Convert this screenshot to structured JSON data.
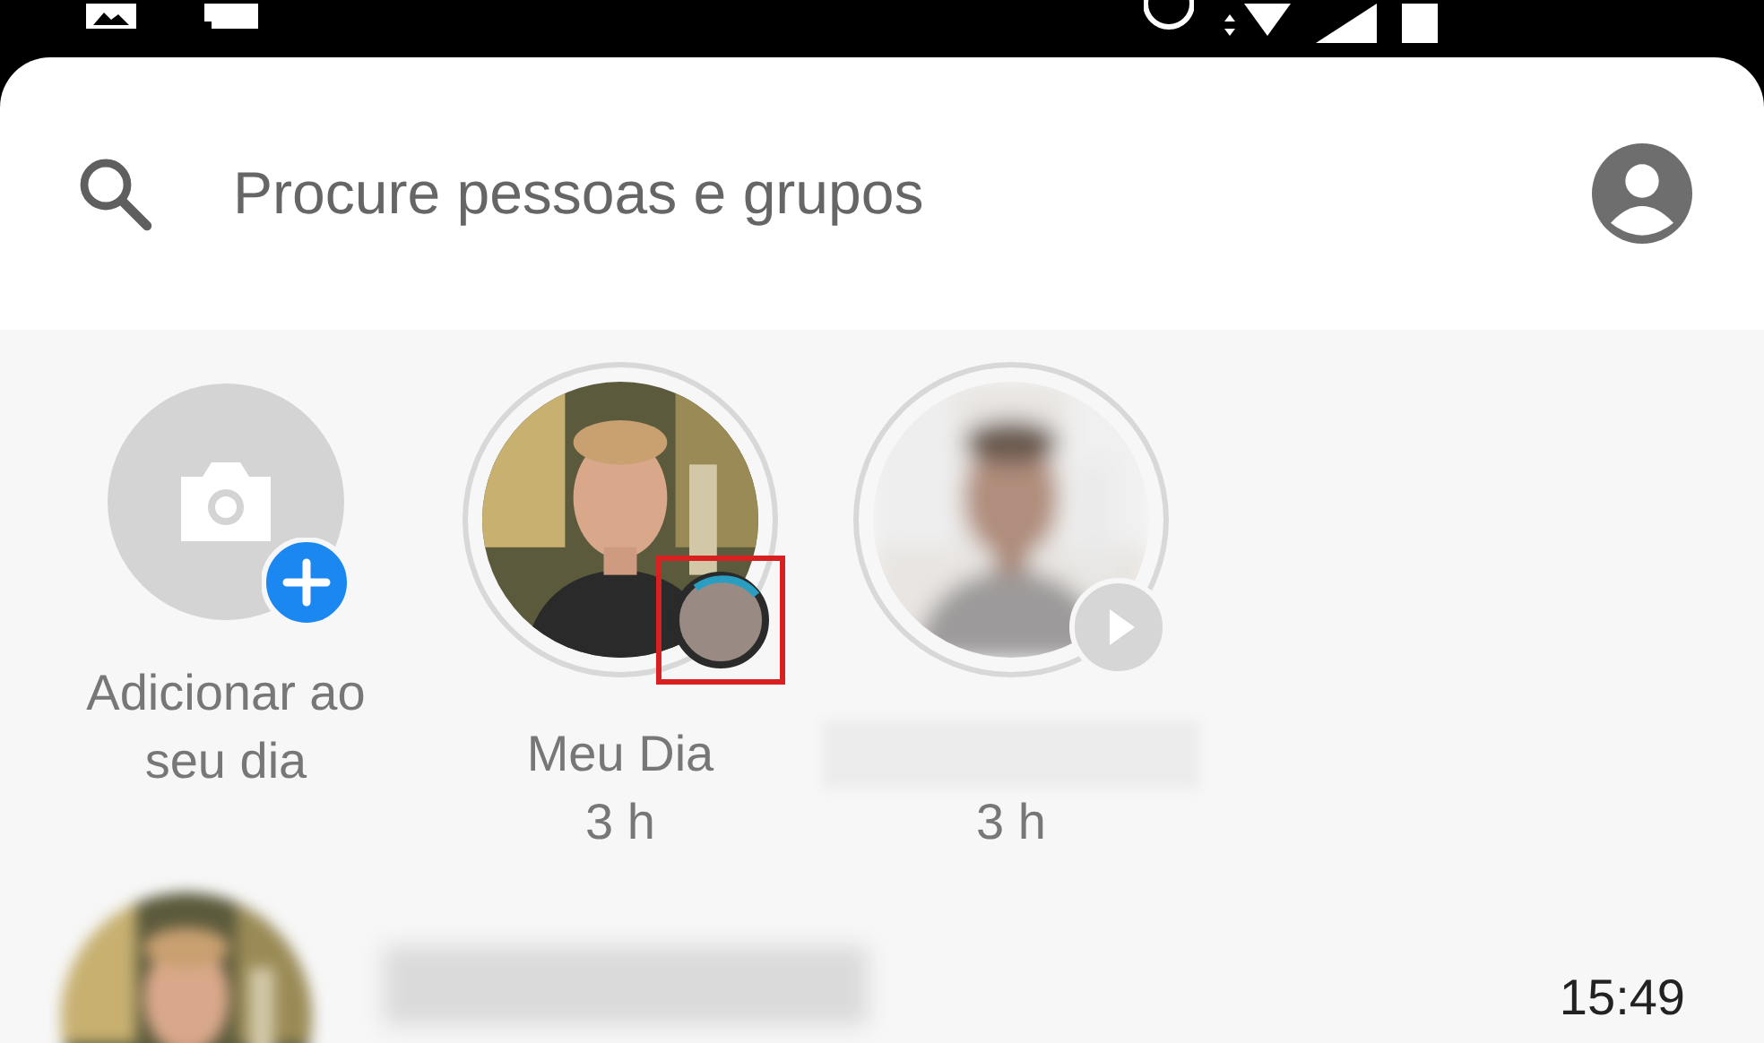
{
  "search": {
    "placeholder": "Procure pessoas e grupos"
  },
  "stories": [
    {
      "kind": "add",
      "label": "Adicionar ao seu dia"
    },
    {
      "kind": "own",
      "label": "Meu Dia",
      "time": "3 h",
      "highlighted": true
    },
    {
      "kind": "friend",
      "time": "3 h",
      "highlighted": false
    }
  ],
  "conversations": [
    {
      "time": "15:49"
    }
  ]
}
